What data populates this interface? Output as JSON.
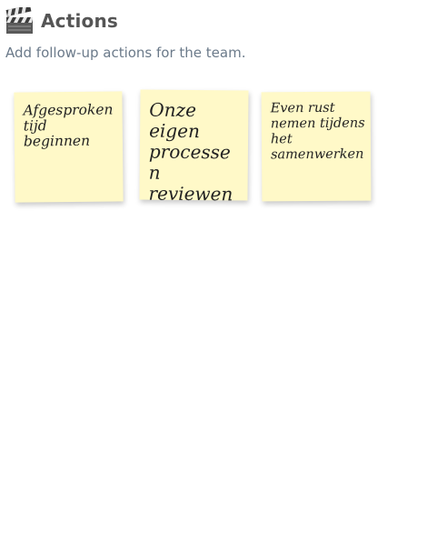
{
  "header": {
    "icon": "clapperboard-icon",
    "title": "Actions",
    "subtitle": "Add follow-up actions for the team."
  },
  "notes": [
    {
      "text": "Afgesproken tijd beginnen"
    },
    {
      "text": "Onze eigen processen reviewen"
    },
    {
      "text": "Even rust nemen tijdens het samenwerken"
    }
  ],
  "colors": {
    "note_background": "#fff9c8",
    "title": "#555555",
    "subtitle": "#6b7a8a"
  }
}
